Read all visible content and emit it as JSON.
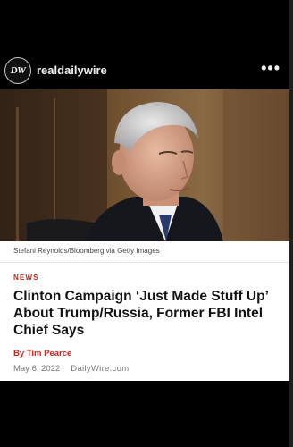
{
  "post": {
    "avatar_text": "DW",
    "username": "realdailywire",
    "more_icon": "more-horizontal-icon",
    "more_label": "•••"
  },
  "article": {
    "photo_description_icon": "news-photo",
    "caption": "Stefani Reynolds/Bloomberg via Getty Images",
    "section": "NEWS",
    "headline": "Clinton Campaign ‘Just Made Stuff Up’ About Trump/Russia, Former FBI Intel Chief Says",
    "byline": "By Tim Pearce",
    "date": "May 6, 2022",
    "site": "DailyWire.com"
  },
  "colors": {
    "background": "#000000",
    "accent": "#c8261d",
    "card": "#ffffff"
  }
}
